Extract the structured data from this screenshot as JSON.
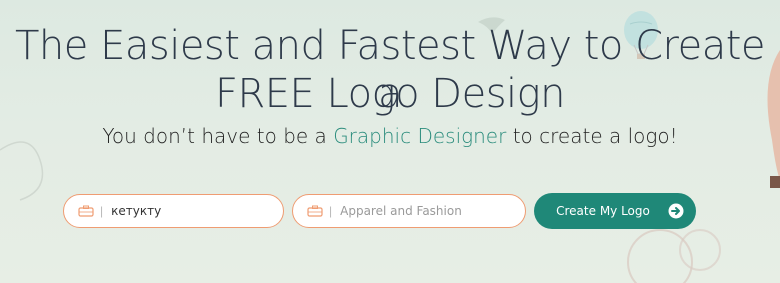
{
  "hero": {
    "title_line1": "The Easiest and Fastest Way to Create a",
    "title_line2": "FREE Logo Design",
    "subtitle_pre": "You don’t have to be a ",
    "subtitle_accent": "Graphic Designer",
    "subtitle_post": " to create a logo!"
  },
  "form": {
    "company_value": "кетукту",
    "company_icon": "briefcase-icon",
    "industry_placeholder": "Apparel and Fashion",
    "industry_icon": "briefcase-icon",
    "separator": "|",
    "submit_label": "Create My Logo",
    "submit_icon": "arrow-right-circle-icon"
  },
  "colors": {
    "accent": "#1f8878",
    "field_border": "#ef9c72",
    "headline": "#2e3a4a"
  }
}
